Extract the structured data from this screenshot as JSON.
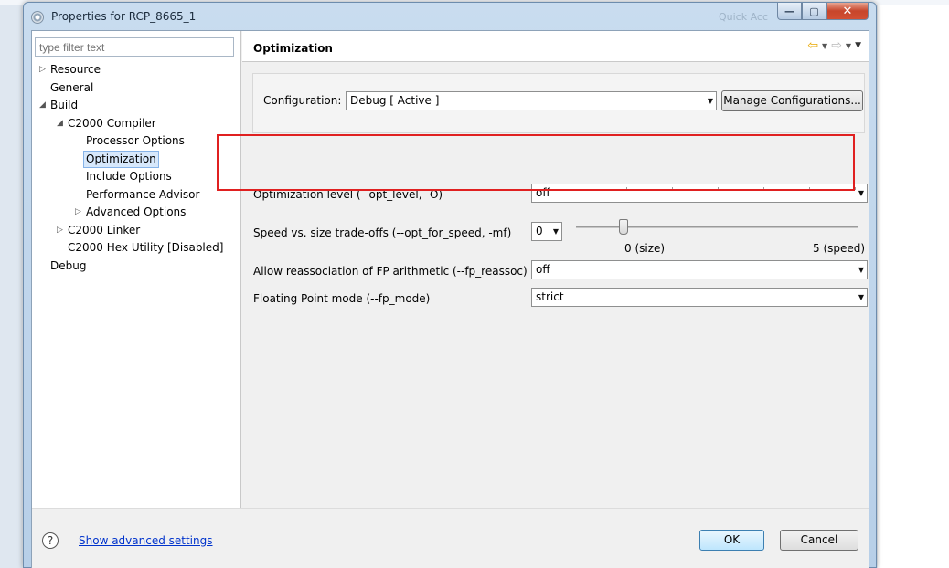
{
  "window": {
    "title": "Properties for RCP_8665_1",
    "ghost_text": "Quick Acc",
    "buttons": {
      "minimize": "—",
      "maximize": "▢",
      "close": "✕"
    }
  },
  "filter": {
    "placeholder": "type filter text"
  },
  "tree": [
    {
      "id": "resource",
      "label": "Resource",
      "twisty": "▷",
      "selected": false
    },
    {
      "id": "general",
      "label": "General",
      "twisty": "",
      "selected": false
    },
    {
      "id": "build",
      "label": "Build",
      "twisty": "◢",
      "selected": false
    },
    {
      "id": "c2000-compiler",
      "label": "C2000 Compiler",
      "twisty": "◢",
      "selected": false
    },
    {
      "id": "processor-options",
      "label": "Processor Options",
      "twisty": "",
      "selected": false
    },
    {
      "id": "optimization",
      "label": "Optimization",
      "twisty": "",
      "selected": true
    },
    {
      "id": "include-options",
      "label": "Include Options",
      "twisty": "",
      "selected": false
    },
    {
      "id": "performance-advisor",
      "label": "Performance Advisor",
      "twisty": "",
      "selected": false
    },
    {
      "id": "advanced-options",
      "label": "Advanced Options",
      "twisty": "▷",
      "selected": false
    },
    {
      "id": "c2000-linker",
      "label": "C2000 Linker",
      "twisty": "▷",
      "selected": false
    },
    {
      "id": "c2000-hex-utility",
      "label": "C2000 Hex Utility  [Disabled]",
      "twisty": "",
      "selected": false
    },
    {
      "id": "debug",
      "label": "Debug",
      "twisty": "",
      "selected": false
    }
  ],
  "page": {
    "title": "Optimization",
    "nav": {
      "back": "⇦",
      "forward": "⇨",
      "dropdown": "▼",
      "menu": "▼"
    }
  },
  "configuration": {
    "label": "Configuration:",
    "value": "Debug  [ Active ]",
    "manage_button": "Manage Configurations..."
  },
  "options": {
    "opt_level": {
      "label": "Optimization level (--opt_level, -O)",
      "value": "off"
    },
    "speed_size": {
      "label": "Speed vs. size trade-offs (--opt_for_speed, -mf)",
      "value": "0",
      "min_label": "0 (size)",
      "max_label": "5 (speed)",
      "slider_level": 0
    },
    "fp_reassoc": {
      "label": "Allow reassociation of FP arithmetic (--fp_reassoc)",
      "value": "off"
    },
    "fp_mode": {
      "label": "Floating Point mode (--fp_mode)",
      "value": "strict"
    }
  },
  "footer": {
    "help_symbol": "?",
    "advanced_link": "Show advanced settings",
    "ok_button": "OK",
    "cancel_button": "Cancel"
  },
  "colors": {
    "highlight_box": "#e02020",
    "link": "#0033cc",
    "selection": "#d7e8fb"
  }
}
